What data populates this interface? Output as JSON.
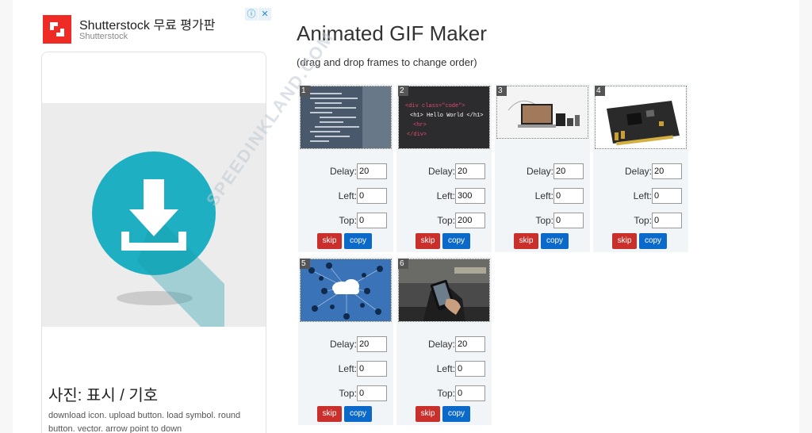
{
  "ad": {
    "title": "Shutterstock 무료 평가판",
    "subtitle": "Shutterstock",
    "choices_icons": [
      "info-icon",
      "close-icon"
    ],
    "caption_title": "사진: 표시 / 기호",
    "caption_desc": "download icon. upload button. load symbol. round button. vector. arrow point to down",
    "brand_color": "#ee2b24",
    "icon_color": "#1eb0c2"
  },
  "main": {
    "title": "Animated GIF Maker",
    "subtitle": "(drag and drop frames to change order)"
  },
  "labels": {
    "delay": "Delay:",
    "left": "Left:",
    "top": "Top:",
    "skip": "skip",
    "copy": "copy"
  },
  "watermark": "SPEEDINKLAND.COM",
  "frames": [
    {
      "num": "1",
      "image": "code-on-monitor",
      "delay": "20",
      "left": "0",
      "top": "0"
    },
    {
      "num": "2",
      "image": "html-code-hello-world",
      "code_line1": "<div class=\"code\">",
      "code_line2": "<h1> Hello World </h1>",
      "code_line3": "<hr>",
      "code_line4": "</div>",
      "delay": "20",
      "left": "300",
      "top": "200"
    },
    {
      "num": "3",
      "image": "laptop-and-tablet",
      "delay": "20",
      "left": "0",
      "top": "0"
    },
    {
      "num": "4",
      "image": "sound-card",
      "delay": "20",
      "left": "0",
      "top": "0"
    },
    {
      "num": "5",
      "image": "cloud-network-icons",
      "delay": "20",
      "left": "0",
      "top": "0"
    },
    {
      "num": "6",
      "image": "hand-holding-phone",
      "delay": "20",
      "left": "0",
      "top": "0"
    }
  ]
}
